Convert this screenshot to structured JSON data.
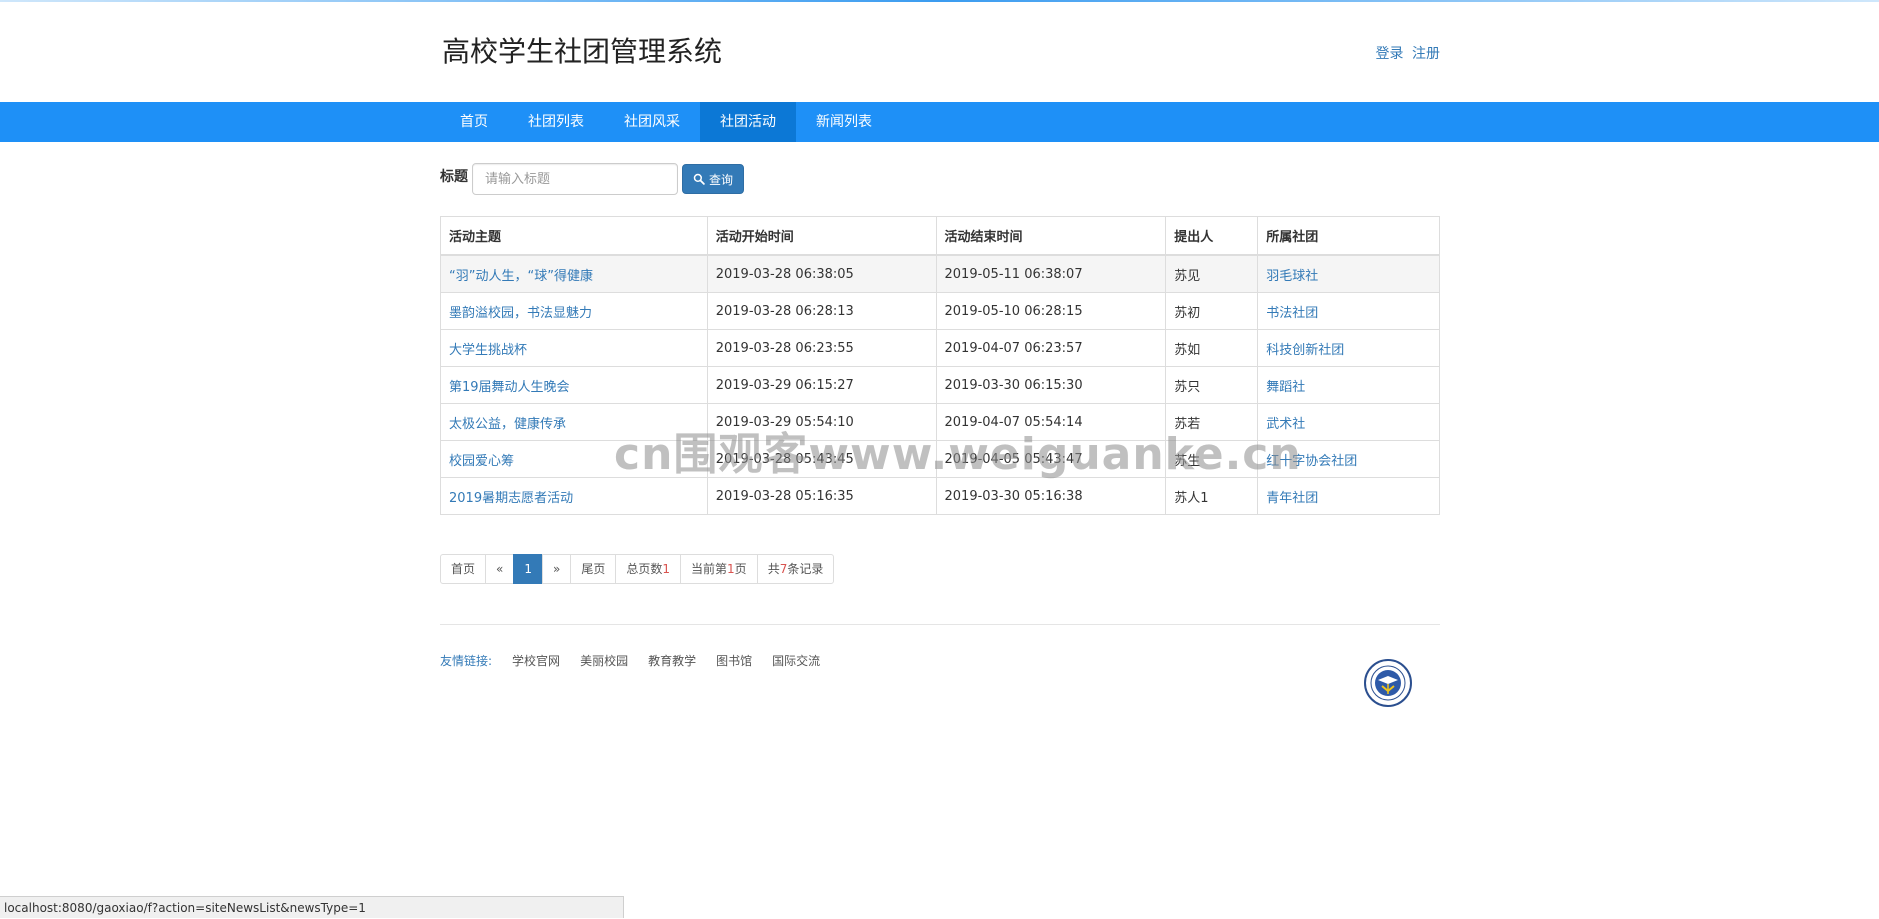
{
  "header": {
    "title": "高校学生社团管理系统",
    "login_label": "登录",
    "register_label": "注册"
  },
  "nav": {
    "items": [
      {
        "label": "首页"
      },
      {
        "label": "社团列表"
      },
      {
        "label": "社团风采"
      },
      {
        "label": "社团活动",
        "active": true
      },
      {
        "label": "新闻列表"
      }
    ]
  },
  "search": {
    "label": "标题",
    "placeholder": "请输入标题",
    "button_label": "查询"
  },
  "table": {
    "headers": [
      "活动主题",
      "活动开始时间",
      "活动结束时间",
      "提出人",
      "所属社团"
    ],
    "rows": [
      {
        "topic": "“羽”动人生，“球”得健康",
        "start": "2019-03-28 06:38:05",
        "end": "2019-05-11 06:38:07",
        "proposer": "苏见",
        "club": "羽毛球社"
      },
      {
        "topic": "墨韵溢校园，书法显魅力",
        "start": "2019-03-28 06:28:13",
        "end": "2019-05-10 06:28:15",
        "proposer": "苏初",
        "club": "书法社团"
      },
      {
        "topic": "大学生挑战杯",
        "start": "2019-03-28 06:23:55",
        "end": "2019-04-07 06:23:57",
        "proposer": "苏如",
        "club": "科技创新社团"
      },
      {
        "topic": "第19届舞动人生晚会",
        "start": "2019-03-29 06:15:27",
        "end": "2019-03-30 06:15:30",
        "proposer": "苏只",
        "club": "舞蹈社"
      },
      {
        "topic": "太极公益，健康传承",
        "start": "2019-03-29 05:54:10",
        "end": "2019-04-07 05:54:14",
        "proposer": "苏若",
        "club": "武术社"
      },
      {
        "topic": "校园爱心筹",
        "start": "2019-03-28 05:43:45",
        "end": "2019-04-05 05:43:47",
        "proposer": "苏生",
        "club": "红十字协会社团"
      },
      {
        "topic": "2019暑期志愿者活动",
        "start": "2019-03-28 05:16:35",
        "end": "2019-03-30 05:16:38",
        "proposer": "苏人1",
        "club": "青年社团"
      }
    ]
  },
  "pager": {
    "first": "首页",
    "prev": "«",
    "current": "1",
    "next": "»",
    "last": "尾页",
    "total_pages_prefix": "总页数",
    "total_pages": "1",
    "current_prefix": "当前第",
    "current_page": "1",
    "current_suffix": "页",
    "records_prefix": "共",
    "records": "7",
    "records_suffix": "条记录"
  },
  "footer": {
    "links_label": "友情链接:",
    "links": [
      "学校官网",
      "美丽校园",
      "教育教学",
      "图书馆",
      "国际交流"
    ]
  },
  "watermark": "cn围观客www.weiguanke.cn",
  "statusbar": {
    "url": "localhost:8080/gaoxiao/f?action=siteNewsList&newsType=1"
  },
  "colors": {
    "nav_bg": "#1e90f7",
    "nav_active": "#0c78d6",
    "link": "#337ab7",
    "button": "#337ab7",
    "pager_accent": "#d9534f"
  }
}
